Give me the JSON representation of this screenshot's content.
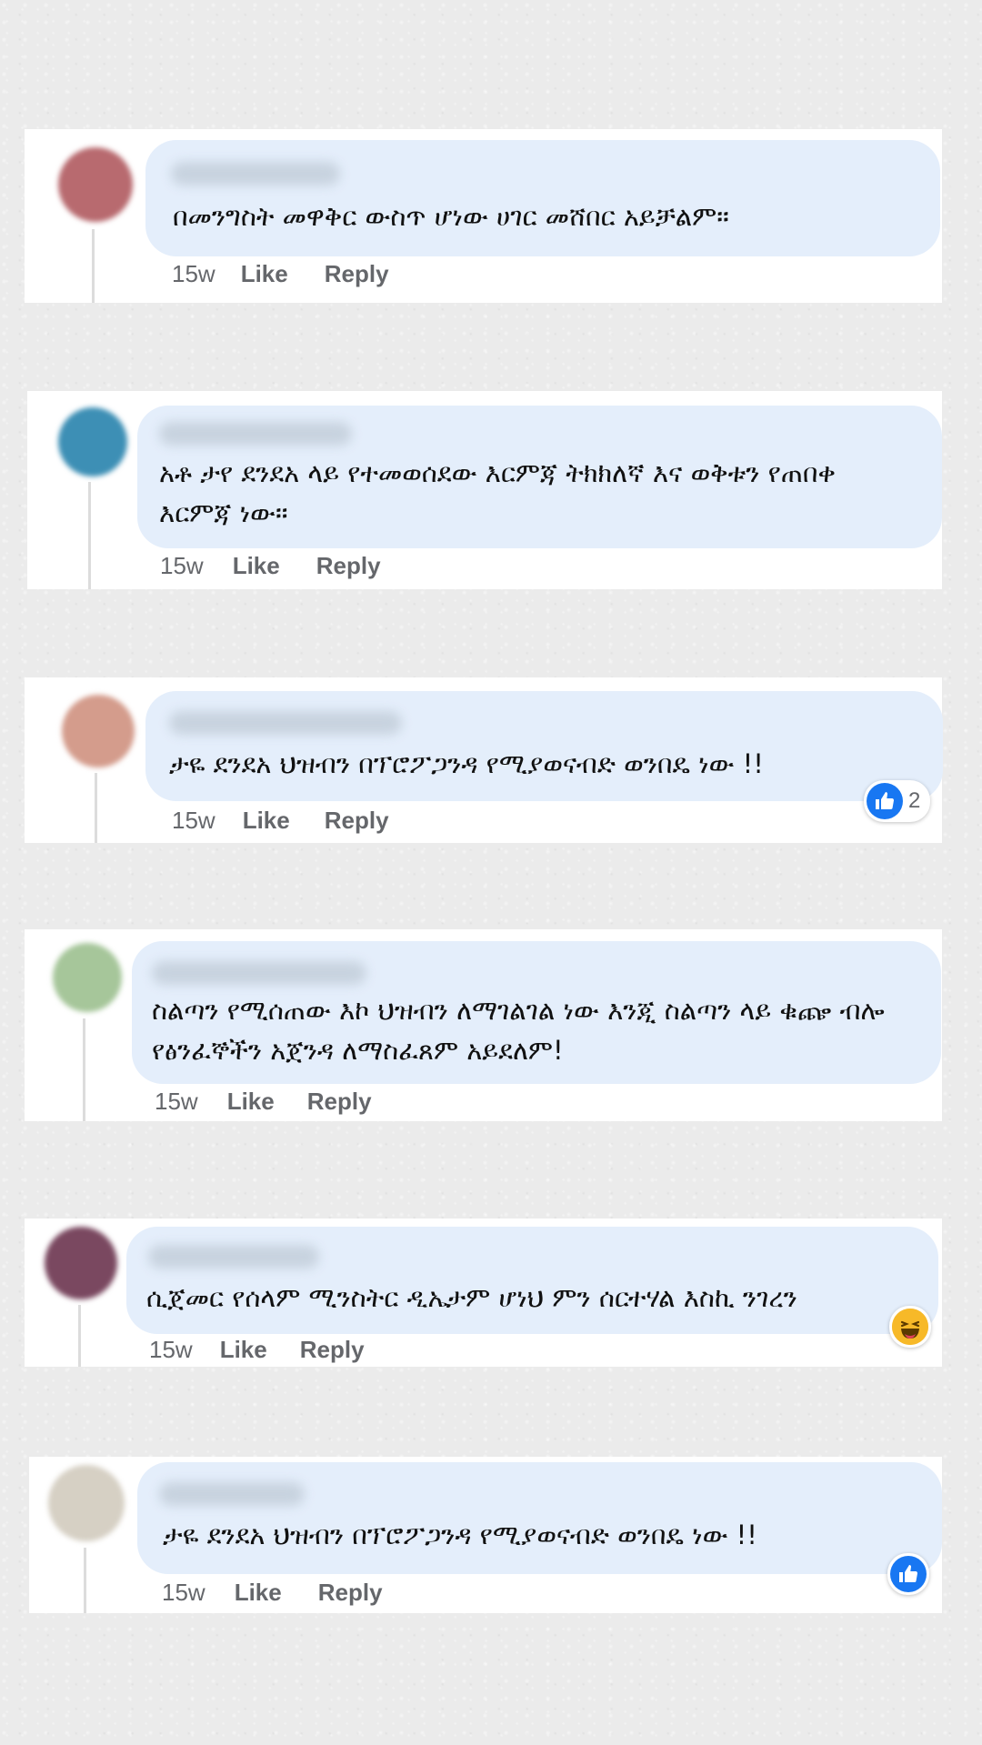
{
  "comments": [
    {
      "text": "በመንግስት መዋቅር ውስጥ ሆነው ሀገር መሸበር አይቻልም።",
      "time": "15w",
      "like": "Like",
      "reply": "Reply",
      "avatar_color": "#b86a6f"
    },
    {
      "text": "አቶ ታየ ደንደአ ላይ የተመወሰደው እርምጃ ትክክለኛ እና ወቅቱን የጠበቀ እርምጃ ነው።",
      "time": "15w",
      "like": "Like",
      "reply": "Reply",
      "avatar_color": "#3d8fb5"
    },
    {
      "text": "ታዬ ደንደአ ህዝብን በፕሮፖጋንዳ የሚያወናብድ ወንበዴ ነው !!",
      "time": "15w",
      "like": "Like",
      "reply": "Reply",
      "avatar_color": "#d49c8c",
      "reaction": {
        "type": "like-icon",
        "count": "2"
      }
    },
    {
      "text": "ስልጣን የሚሰጠው እኮ ህዝብን ለማገልገል ነው እንጂ ስልጣን ላይ ቁጬ ብሎ የፅንፈኞችን አጀንዳ ለማስፈጸም አይደለም!",
      "time": "15w",
      "like": "Like",
      "reply": "Reply",
      "avatar_color": "#a6c69a"
    },
    {
      "text": "ሲጀመር የሰላም ሚንስትር ዲኤታም ሆነህ ምን ሰርተሃል እስኪ ንገረን",
      "time": "15w",
      "like": "Like",
      "reply": "Reply",
      "avatar_color": "#7a4860",
      "reaction": {
        "type": "haha-icon"
      }
    },
    {
      "text": "ታዬ ደንደአ ህዝብን በፕሮፖጋንዳ የሚያወናብድ ወንበዴ ነው !!",
      "time": "15w",
      "like": "Like",
      "reply": "Reply",
      "avatar_color": "#d6d0c4",
      "reaction": {
        "type": "like-icon"
      }
    }
  ],
  "colors": {
    "bubble": "#e4eefb",
    "like_blue": "#1877f2",
    "meta_gray": "#65676b"
  }
}
